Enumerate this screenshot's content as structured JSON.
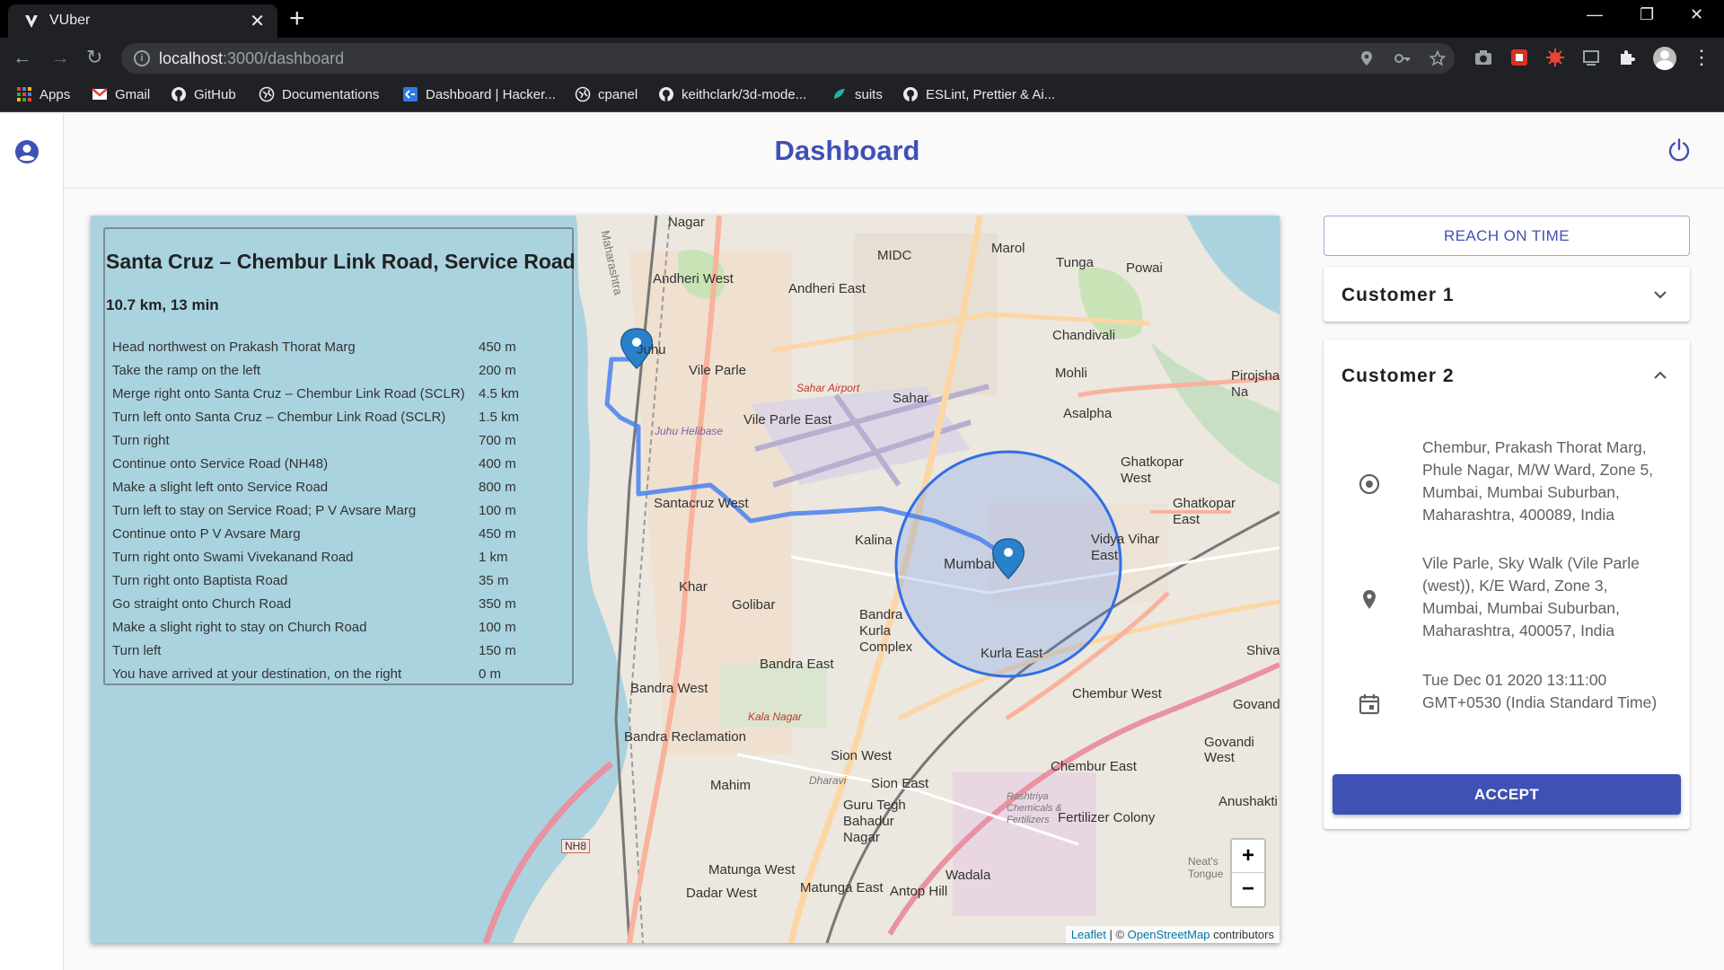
{
  "browser": {
    "tab_title": "VUber",
    "url_host": "localhost",
    "url_path": ":3000/dashboard",
    "bookmarks": [
      "Apps",
      "Gmail",
      "GitHub",
      "Documentations",
      "Dashboard | Hacker...",
      "cpanel",
      "keithclark/3d-mode...",
      "suits",
      "ESLint, Prettier & Ai..."
    ]
  },
  "header": {
    "title": "Dashboard"
  },
  "route": {
    "title": "Santa Cruz – Chembur Link Road, Service Road",
    "summary": "10.7 km, 13 min",
    "steps": [
      {
        "instruction": "Head northwest on Prakash Thorat Marg",
        "distance": "450 m"
      },
      {
        "instruction": "Take the ramp on the left",
        "distance": "200 m"
      },
      {
        "instruction": "Merge right onto Santa Cruz – Chembur Link Road (SCLR)",
        "distance": "4.5 km"
      },
      {
        "instruction": "Turn left onto Santa Cruz – Chembur Link Road (SCLR)",
        "distance": "1.5 km"
      },
      {
        "instruction": "Turn right",
        "distance": "700 m"
      },
      {
        "instruction": "Continue onto Service Road (NH48)",
        "distance": "400 m"
      },
      {
        "instruction": "Make a slight left onto Service Road",
        "distance": "800 m"
      },
      {
        "instruction": "Turn left to stay on Service Road; P V Avsare Marg",
        "distance": "100 m"
      },
      {
        "instruction": "Continue onto P V Avsare Marg",
        "distance": "450 m"
      },
      {
        "instruction": "Turn right onto Swami Vivekanand Road",
        "distance": "1 km"
      },
      {
        "instruction": "Turn right onto Baptista Road",
        "distance": "35 m"
      },
      {
        "instruction": "Go straight onto Church Road",
        "distance": "350 m"
      },
      {
        "instruction": "Make a slight right to stay on Church Road",
        "distance": "100 m"
      },
      {
        "instruction": "Turn left",
        "distance": "150 m"
      },
      {
        "instruction": "You have arrived at your destination, on the right",
        "distance": "0 m"
      }
    ]
  },
  "map": {
    "labels": [
      "Nagar",
      "MIDC",
      "Andheri West",
      "Andheri East",
      "Marol",
      "Tunga",
      "Powai",
      "Juhu",
      "Vile Parle",
      "Chandivali",
      "Sahar Airport",
      "Sahar",
      "Mohli",
      "Vile Parle East",
      "Juhu Helibase",
      "Asalpha",
      "Ghatkopar West",
      "Ghatkopar East",
      "Santacruz West",
      "Kalina",
      "Mumbai",
      "Vidya Vihar East",
      "Khar",
      "Golibar",
      "Bandra Kurla Complex",
      "Kurla East",
      "Chembur West",
      "Bandra East",
      "Bandra West",
      "Kala Nagar",
      "Bandra Reclamation",
      "Sion West",
      "Mahim",
      "Sion East",
      "Dharavi",
      "Guru Tegh Bahadur Nagar",
      "Fertilizer Colony",
      "Chembur East",
      "Govandi West",
      "Anushakti",
      "Matunga West",
      "Matunga East",
      "Dadar West",
      "Antop Hill",
      "Wadala",
      "NH8",
      "Shiva",
      "Govand",
      "Rashtriya Chemicals & Fertilizers",
      "Pirojsha Na",
      "Neat's Tongue",
      "Maharashtra"
    ],
    "zoom_in": "+",
    "zoom_out": "−",
    "attribution_leaflet": "Leaflet",
    "attribution_sep": " | © ",
    "attribution_osm": "OpenStreetMap",
    "attribution_tail": " contributors"
  },
  "panel": {
    "reach_on_time": "REACH ON TIME",
    "customer1": {
      "title": "Customer 1"
    },
    "customer2": {
      "title": "Customer 2",
      "pickup": "Chembur, Prakash Thorat Marg, Phule Nagar, M/W Ward, Zone 5, Mumbai, Mumbai Suburban, Maharashtra, 400089, India",
      "drop": "Vile Parle, Sky Walk (Vile Parle (west)), K/E Ward, Zone 3, Mumbai, Mumbai Suburban, Maharashtra, 400057, India",
      "time": "Tue Dec 01 2020 13:11:00 GMT+0530 (India Standard Time)",
      "accept": "ACCEPT"
    }
  },
  "colors": {
    "primary": "#3f51b5",
    "route": "#4a80f0",
    "water": "#aad3df"
  }
}
